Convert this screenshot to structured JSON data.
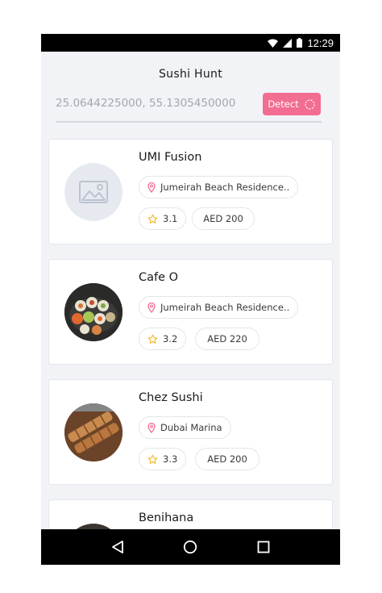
{
  "status_bar": {
    "time": "12:29"
  },
  "header": {
    "title": "Sushi Hunt",
    "coordinates": "25.0644225000, 55.1305450000",
    "detect_label": "Detect"
  },
  "restaurants": [
    {
      "name": "UMI Fusion",
      "location": "Jumeirah Beach Residence..",
      "rating": "3.1",
      "price": "AED 200",
      "image": "placeholder-image-icon"
    },
    {
      "name": "Cafe O",
      "location": "Jumeirah Beach Residence..",
      "rating": "3.2",
      "price": "AED 220",
      "image": "sushi-platter-photo"
    },
    {
      "name": "Chez Sushi",
      "location": "Dubai Marina",
      "rating": "3.3",
      "price": "AED 200",
      "image": "sushi-rolls-photo"
    },
    {
      "name": "Benihana",
      "image": "restaurant-photo"
    }
  ],
  "colors": {
    "accent": "#f26d92",
    "star": "#f5b731",
    "background": "#f1f3f7"
  }
}
